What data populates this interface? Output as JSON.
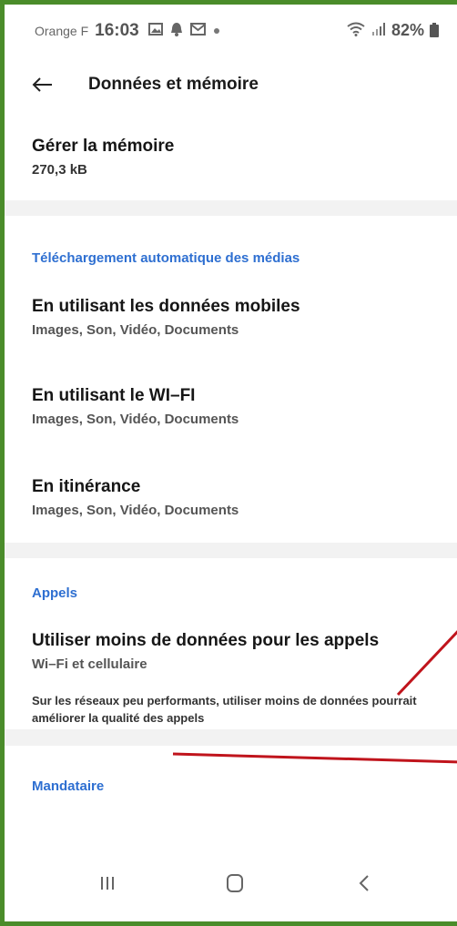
{
  "status_bar": {
    "carrier": "Orange F",
    "time": "16:03",
    "battery": "82%",
    "icons": [
      "gallery-icon",
      "ring-icon",
      "message-icon",
      "dot-icon",
      "wifi-icon",
      "signal-icon",
      "battery-icon"
    ]
  },
  "header": {
    "title": "Données et mémoire"
  },
  "storage": {
    "title": "Gérer la mémoire",
    "size": "270,3 kB"
  },
  "media_download": {
    "section_title": "Téléchargement automatique des médias",
    "items": [
      {
        "title": "En utilisant les données mobiles",
        "subtitle": "Images, Son, Vidéo, Documents"
      },
      {
        "title": "En utilisant le WI–FI",
        "subtitle": "Images, Son, Vidéo, Documents"
      },
      {
        "title": "En itinérance",
        "subtitle": "Images, Son, Vidéo, Documents"
      }
    ]
  },
  "calls": {
    "section_title": "Appels",
    "item_title": "Utiliser moins de données pour les appels",
    "item_subtitle": "Wi–Fi et cellulaire",
    "description": "Sur les réseaux peu performants, utiliser moins de données pourrait améliorer la qualité des appels"
  },
  "proxy": {
    "section_title": "Mandataire"
  },
  "colors": {
    "accent_blue": "#2e6fd1",
    "frame_green": "#4a8c2a",
    "annotation_red": "#c0141c"
  }
}
